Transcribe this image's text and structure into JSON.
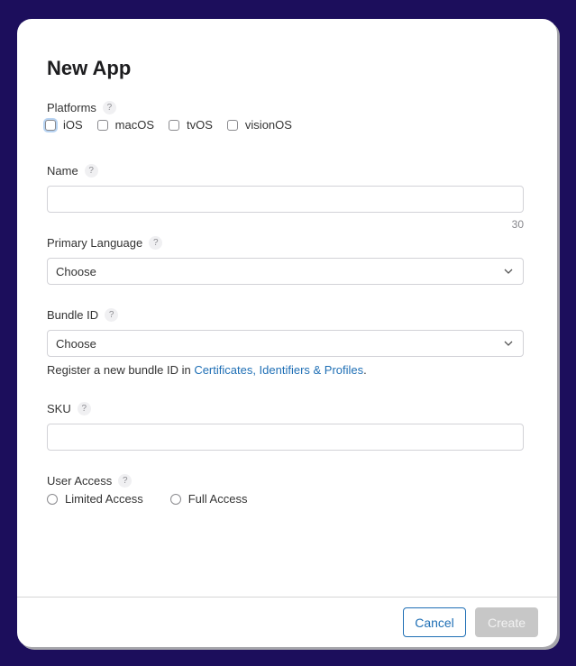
{
  "dialog": {
    "title": "New App",
    "platforms": {
      "label": "Platforms",
      "help": "?",
      "options": [
        {
          "label": "iOS",
          "checked": false,
          "focused": true
        },
        {
          "label": "macOS",
          "checked": false
        },
        {
          "label": "tvOS",
          "checked": false
        },
        {
          "label": "visionOS",
          "checked": false
        }
      ]
    },
    "name": {
      "label": "Name",
      "help": "?",
      "value": "",
      "char_limit": "30"
    },
    "primary_language": {
      "label": "Primary Language",
      "help": "?",
      "selected": "Choose"
    },
    "bundle_id": {
      "label": "Bundle ID",
      "help": "?",
      "selected": "Choose",
      "hint_prefix": "Register a new bundle ID in ",
      "hint_link": "Certificates, Identifiers & Profiles",
      "hint_suffix": "."
    },
    "sku": {
      "label": "SKU",
      "help": "?",
      "value": ""
    },
    "user_access": {
      "label": "User Access",
      "help": "?",
      "options": [
        {
          "label": "Limited Access",
          "selected": false
        },
        {
          "label": "Full Access",
          "selected": false
        }
      ]
    },
    "footer": {
      "cancel_label": "Cancel",
      "create_label": "Create"
    }
  },
  "colors": {
    "backdrop": "#1c0e5c",
    "link": "#1f6fb5",
    "disabled_button": "#c7c7c7"
  }
}
